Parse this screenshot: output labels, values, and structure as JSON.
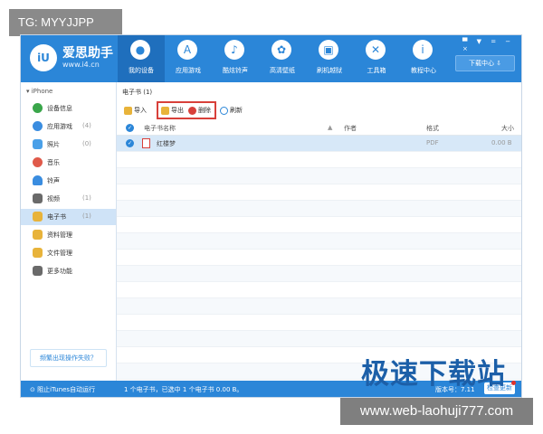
{
  "watermark_top_left": "TG: MYYJJPP",
  "watermark_bottom_right": "www.web-laohuji777.com",
  "overlay_logo_text": "极速下载站",
  "app": {
    "brand": "爱思助手",
    "url": "www.i4.cn",
    "logo_text": "iU",
    "nav": [
      {
        "label": "我的设备",
        "icon": "apple-icon",
        "glyph": ""
      },
      {
        "label": "应用游戏",
        "icon": "app-store-icon",
        "glyph": "A"
      },
      {
        "label": "酷炫铃声",
        "icon": "bell-icon",
        "glyph": "♪"
      },
      {
        "label": "高清壁纸",
        "icon": "flower-icon",
        "glyph": "✿"
      },
      {
        "label": "刷机越狱",
        "icon": "box-icon",
        "glyph": "▣"
      },
      {
        "label": "工具箱",
        "icon": "tools-icon",
        "glyph": "✕"
      },
      {
        "label": "教程中心",
        "icon": "info-icon",
        "glyph": "i"
      }
    ],
    "window_controls": "▀ ▼ = − ×",
    "download_center": "下载中心 ⇩",
    "device_label": "▾ iPhone",
    "sidebar": [
      {
        "label": "设备信息",
        "count": "",
        "color": "#3aa64a"
      },
      {
        "label": "应用游戏",
        "count": "(4)",
        "color": "#3a8de0"
      },
      {
        "label": "照片",
        "count": "(0)",
        "color": "#4aa0e8"
      },
      {
        "label": "音乐",
        "count": "",
        "color": "#e05a4a"
      },
      {
        "label": "铃声",
        "count": "",
        "color": "#3a8de0"
      },
      {
        "label": "视频",
        "count": "(1)",
        "color": "#6a6a6a"
      },
      {
        "label": "电子书",
        "count": "(1)",
        "color": "#e8b33a"
      },
      {
        "label": "资料管理",
        "count": "",
        "color": "#e8b33a"
      },
      {
        "label": "文件管理",
        "count": "",
        "color": "#e8b33a"
      },
      {
        "label": "更多功能",
        "count": "",
        "color": "#6a6a6a"
      }
    ],
    "help_button": "频繁出现操作失败？",
    "content_title": "电子书 (1)",
    "toolbar": {
      "import": "导入",
      "export": "导出",
      "delete": "删除",
      "refresh": "刷新"
    },
    "table": {
      "col_name": "电子书名称",
      "col_author": "作者",
      "col_format": "格式",
      "col_size": "大小",
      "sort_glyph": "▲",
      "rows": [
        {
          "name": "红楼梦",
          "author": "",
          "format": "PDF",
          "size": "0.00 B"
        }
      ]
    },
    "status": {
      "itunes": "阻止iTunes自动运行",
      "summary": "1 个电子书，已选中 1 个电子书 0.00 B。",
      "version": "版本号：7.11",
      "check_update": "检查更新"
    },
    "colors": {
      "accent": "#2b86d8",
      "highlight": "#d8403a",
      "selected_row": "#d7e8f8"
    }
  }
}
